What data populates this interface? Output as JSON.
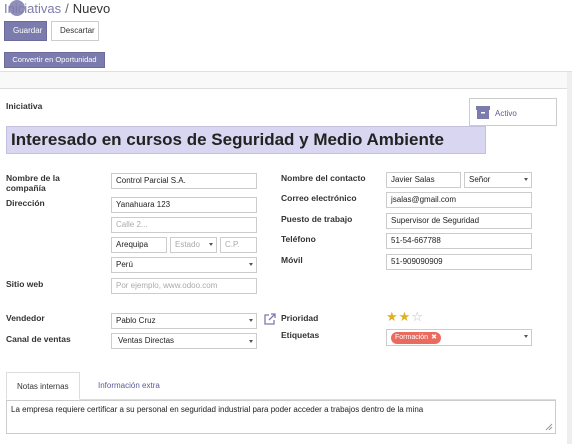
{
  "breadcrumb": {
    "parent": "Iniciativas",
    "separator": "/",
    "current": "Nuevo"
  },
  "toolbar": {
    "save_label": "Guardar",
    "discard_label": "Descartar"
  },
  "statusbar": {
    "convert_label": "Convertir en Oportunidad"
  },
  "form": {
    "section_label": "Iniciativa",
    "title": "Interesado en cursos de Seguridad y Medio Ambiente",
    "active_label": "Activo",
    "left": {
      "company_label": "Nombre de la compañía",
      "company_value": "Control Parcial S.A.",
      "address_label": "Dirección",
      "street": "Yanahuara 123",
      "street2_placeholder": "Calle 2...",
      "city": "Arequipa",
      "state_placeholder": "Estado",
      "zip_placeholder": "C.P.",
      "country": "Perú",
      "website_label": "Sitio web",
      "website_placeholder": "Por ejemplo, www.odoo.com",
      "salesperson_label": "Vendedor",
      "salesperson_value": "Pablo Cruz",
      "channel_label": "Canal de ventas",
      "channel_value": "Ventas Directas"
    },
    "right": {
      "contact_label": "Nombre del contacto",
      "contact_name": "Javier Salas",
      "contact_title": "Señor",
      "email_label": "Correo electrónico",
      "email_value": "jsalas@gmail.com",
      "job_label": "Puesto de trabajo",
      "job_value": "Supervisor de Seguridad",
      "phone_label": "Teléfono",
      "phone_value": "51-54-667788",
      "mobile_label": "Móvil",
      "mobile_value": "51-909090909",
      "priority_label": "Prioridad",
      "priority_stars": 2,
      "priority_max": 3,
      "tags_label": "Etiquetas",
      "tag": "Formación"
    }
  },
  "tabs": [
    {
      "label": "Notas internas",
      "active": true
    },
    {
      "label": "Información extra",
      "active": false
    }
  ],
  "notes": {
    "text": "La empresa requiere certificar a su personal en seguridad industrial para poder acceder a trabajos dentro de la mina"
  },
  "colors": {
    "primary": "#7c7bad",
    "title_bg": "#d8d6f0",
    "tag": "#ea6b5e",
    "star": "#e0b020"
  }
}
